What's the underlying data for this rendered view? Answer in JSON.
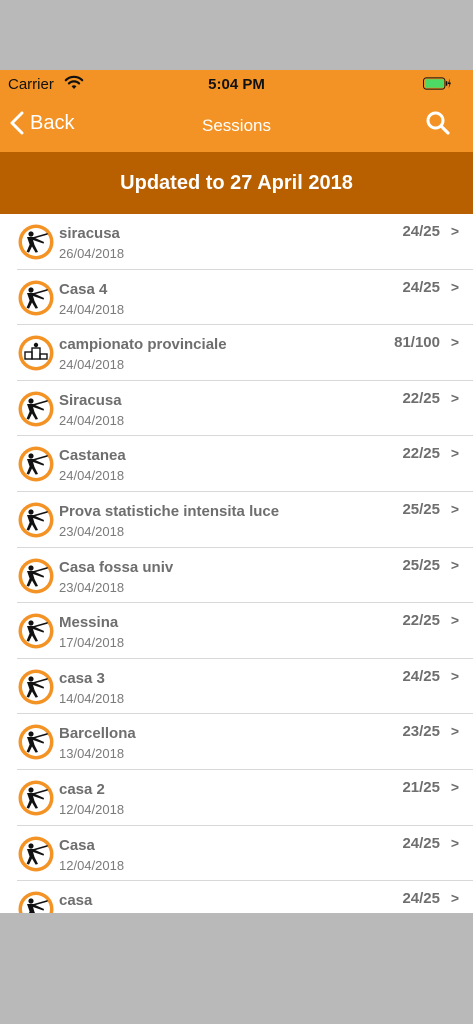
{
  "status_bar": {
    "carrier": "Carrier",
    "time": "5:04 PM"
  },
  "nav": {
    "back_label": "Back",
    "title": "Sessions"
  },
  "banner": {
    "text": "Updated to 27 April 2018"
  },
  "colors": {
    "orange": "#f39325",
    "banner": "#b85f00",
    "text_gray": "#6e6e6e"
  },
  "sessions": [
    {
      "name": "siracusa",
      "date": "26/04/2018",
      "score": "24/25",
      "icon": "shooter-icon"
    },
    {
      "name": "Casa 4",
      "date": "24/04/2018",
      "score": "24/25",
      "icon": "shooter-icon"
    },
    {
      "name": "campionato provinciale",
      "date": "24/04/2018",
      "score": "81/100",
      "icon": "podium-icon"
    },
    {
      "name": "Siracusa",
      "date": "24/04/2018",
      "score": "22/25",
      "icon": "shooter-icon"
    },
    {
      "name": "Castanea",
      "date": "24/04/2018",
      "score": "22/25",
      "icon": "shooter-icon"
    },
    {
      "name": "Prova statistiche intensita luce",
      "date": "23/04/2018",
      "score": "25/25",
      "icon": "shooter-icon"
    },
    {
      "name": "Casa fossa univ",
      "date": "23/04/2018",
      "score": "25/25",
      "icon": "shooter-icon"
    },
    {
      "name": "Messina",
      "date": "17/04/2018",
      "score": "22/25",
      "icon": "shooter-icon"
    },
    {
      "name": "casa 3",
      "date": "14/04/2018",
      "score": "24/25",
      "icon": "shooter-icon"
    },
    {
      "name": "Barcellona",
      "date": "13/04/2018",
      "score": "23/25",
      "icon": "shooter-icon"
    },
    {
      "name": "casa 2",
      "date": "12/04/2018",
      "score": "21/25",
      "icon": "shooter-icon"
    },
    {
      "name": "Casa",
      "date": "12/04/2018",
      "score": "24/25",
      "icon": "shooter-icon"
    },
    {
      "name": "casa",
      "date": "",
      "score": "24/25",
      "icon": "shooter-icon"
    }
  ],
  "chevron": ">"
}
